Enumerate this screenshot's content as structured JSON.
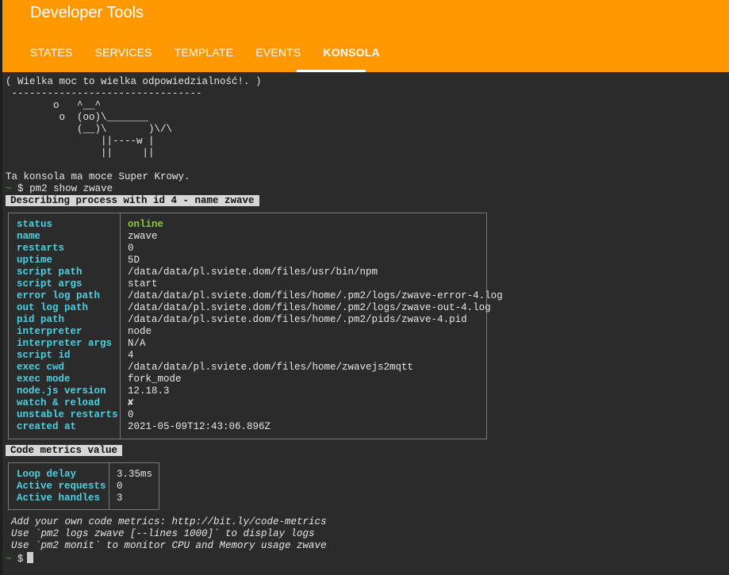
{
  "header": {
    "title": "Developer Tools",
    "tabs": [
      "STATES",
      "SERVICES",
      "TEMPLATE",
      "EVENTS",
      "KONSOLA"
    ],
    "active_tab": "KONSOLA"
  },
  "terminal": {
    "cowsay": [
      "( Wielka moc to wielka odpowiedzialność!. )",
      " --------------------------------",
      "        o   ^__^",
      "         o  (oo)\\_______",
      "            (__)\\       )\\/\\",
      "                ||----w |",
      "                ||     ||"
    ],
    "intro": "Ta konsola ma moce Super Krowy.",
    "prompt_symbol": "~",
    "prompt_dollar": "$",
    "command": "pm2 show zwave",
    "describe_header": "Describing process with id 4 - name zwave",
    "process_info": [
      {
        "key": "status",
        "value": "online"
      },
      {
        "key": "name",
        "value": "zwave"
      },
      {
        "key": "restarts",
        "value": "0"
      },
      {
        "key": "uptime",
        "value": "5D"
      },
      {
        "key": "script path",
        "value": "/data/data/pl.sviete.dom/files/usr/bin/npm"
      },
      {
        "key": "script args",
        "value": "start"
      },
      {
        "key": "error log path",
        "value": "/data/data/pl.sviete.dom/files/home/.pm2/logs/zwave-error-4.log"
      },
      {
        "key": "out log path",
        "value": "/data/data/pl.sviete.dom/files/home/.pm2/logs/zwave-out-4.log"
      },
      {
        "key": "pid path",
        "value": "/data/data/pl.sviete.dom/files/home/.pm2/pids/zwave-4.pid"
      },
      {
        "key": "interpreter",
        "value": "node"
      },
      {
        "key": "interpreter args",
        "value": "N/A"
      },
      {
        "key": "script id",
        "value": "4"
      },
      {
        "key": "exec cwd",
        "value": "/data/data/pl.sviete.dom/files/home/zwavejs2mqtt"
      },
      {
        "key": "exec mode",
        "value": "fork_mode"
      },
      {
        "key": "node.js version",
        "value": "12.18.3"
      },
      {
        "key": "watch & reload",
        "value": "✘"
      },
      {
        "key": "unstable restarts",
        "value": "0"
      },
      {
        "key": "created at",
        "value": "2021-05-09T12:43:06.896Z"
      }
    ],
    "metrics_header": "Code metrics value",
    "metrics": [
      {
        "key": "Loop delay",
        "value": "3.35ms"
      },
      {
        "key": "Active requests",
        "value": "0"
      },
      {
        "key": "Active handles",
        "value": "3"
      }
    ],
    "hints": [
      "Add your own code metrics: http://bit.ly/code-metrics",
      "Use `pm2 logs zwave [--lines 1000]` to display logs",
      "Use `pm2 monit` to monitor CPU and Memory usage zwave"
    ]
  }
}
